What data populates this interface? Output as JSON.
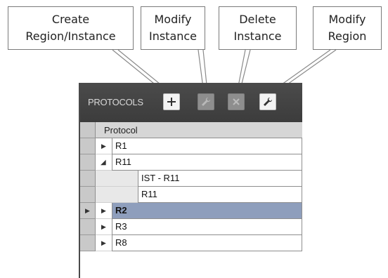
{
  "callouts": {
    "create": [
      "Create",
      "Region/Instance"
    ],
    "modify_instance": [
      "Modify",
      "Instance"
    ],
    "delete_instance": [
      "Delete",
      "Instance"
    ],
    "modify_region": [
      "Modify",
      "Region"
    ]
  },
  "panel": {
    "title": "PROTOCOLS",
    "toolbar": [
      {
        "name": "create",
        "icon": "plus-icon",
        "enabled": true
      },
      {
        "name": "modify-instance",
        "icon": "wrench-icon",
        "enabled": false
      },
      {
        "name": "delete-instance",
        "icon": "x-icon",
        "enabled": false
      },
      {
        "name": "modify-region",
        "icon": "wrench-icon",
        "enabled": true
      }
    ]
  },
  "grid": {
    "header": "Protocol",
    "rows": [
      {
        "label": "R1",
        "expand": "collapsed",
        "level": 0,
        "selected": false
      },
      {
        "label": "R11",
        "expand": "expanded",
        "level": 0,
        "selected": false
      },
      {
        "label": "IST - R11",
        "expand": "none",
        "level": 1,
        "selected": false
      },
      {
        "label": "R11",
        "expand": "none",
        "level": 1,
        "selected": false
      },
      {
        "label": "R2",
        "expand": "collapsed",
        "level": 0,
        "selected": true
      },
      {
        "label": "R3",
        "expand": "collapsed",
        "level": 0,
        "selected": false
      },
      {
        "label": "R8",
        "expand": "collapsed",
        "level": 0,
        "selected": false
      }
    ]
  },
  "colors": {
    "toolbar_bg": "#444444",
    "selected_row": "#8e9ebc",
    "row_selector": "#c9c9c9"
  }
}
